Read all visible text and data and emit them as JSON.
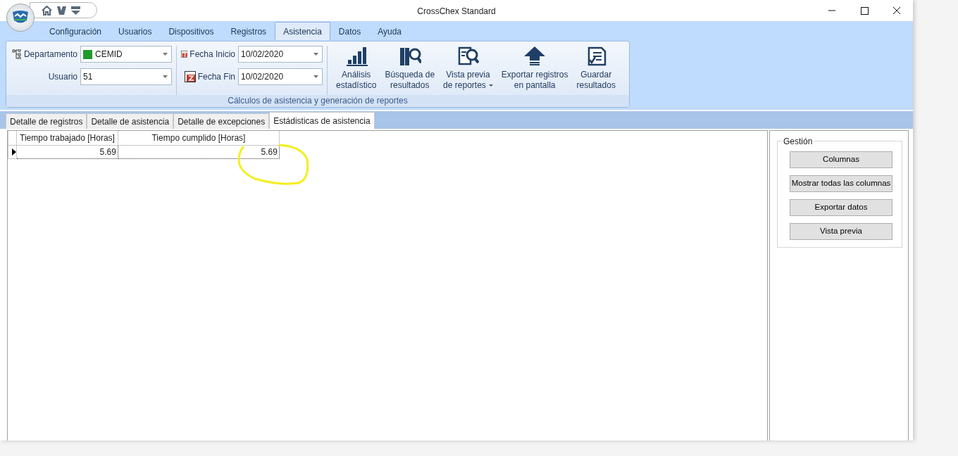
{
  "window": {
    "title": "CrossChex Standard"
  },
  "menu_tabs": [
    {
      "label": "Configuración",
      "selected": false
    },
    {
      "label": "Usuarios",
      "selected": false
    },
    {
      "label": "Dispositivos",
      "selected": false
    },
    {
      "label": "Registros",
      "selected": false
    },
    {
      "label": "Asistencia",
      "selected": true
    },
    {
      "label": "Datos",
      "selected": false
    },
    {
      "label": "Ayuda",
      "selected": false
    }
  ],
  "department": {
    "label": "Departamento",
    "value": "CEMID",
    "color": "#1f9a2b"
  },
  "user": {
    "label": "Usuario",
    "value": "51"
  },
  "start_date": {
    "label": "Fecha Inicio",
    "value": "10/02/2020"
  },
  "end_date": {
    "label": "Fecha Fin",
    "value": "10/02/2020"
  },
  "ribbon_buttons": [
    {
      "kind": "chart",
      "lines": [
        "Análisis",
        "estadístico"
      ],
      "dropdown": false
    },
    {
      "kind": "search",
      "lines": [
        "Búsqueda de",
        "resultados"
      ],
      "dropdown": false
    },
    {
      "kind": "preview",
      "lines": [
        "Vista previa",
        "de reportes"
      ],
      "dropdown": true
    },
    {
      "kind": "export",
      "lines": [
        "Exportar registros",
        "en pantalla"
      ],
      "dropdown": false
    },
    {
      "kind": "save",
      "lines": [
        "Guardar",
        "resultados"
      ],
      "dropdown": false
    }
  ],
  "ribbon_group": "Cálculos de asistencia y generación de reportes",
  "view_tabs": [
    {
      "label": "Detalle de registros",
      "selected": false
    },
    {
      "label": "Detalle de asistencia",
      "selected": false
    },
    {
      "label": "Detalle de excepciones",
      "selected": false
    },
    {
      "label": "Estádisticas de asistencia",
      "selected": true
    }
  ],
  "table": {
    "columns": [
      "Tiempo trabajado [Horas]",
      "Tiempo cumplido [Horas]"
    ],
    "rows": [
      {
        "current": true,
        "cells": [
          "5.69",
          "5.69"
        ]
      }
    ]
  },
  "side_panel": {
    "title": "Gestión",
    "buttons": [
      "Columnas",
      "Mostrar todas las columnas",
      "Exportar datos",
      "Vista previa"
    ]
  }
}
